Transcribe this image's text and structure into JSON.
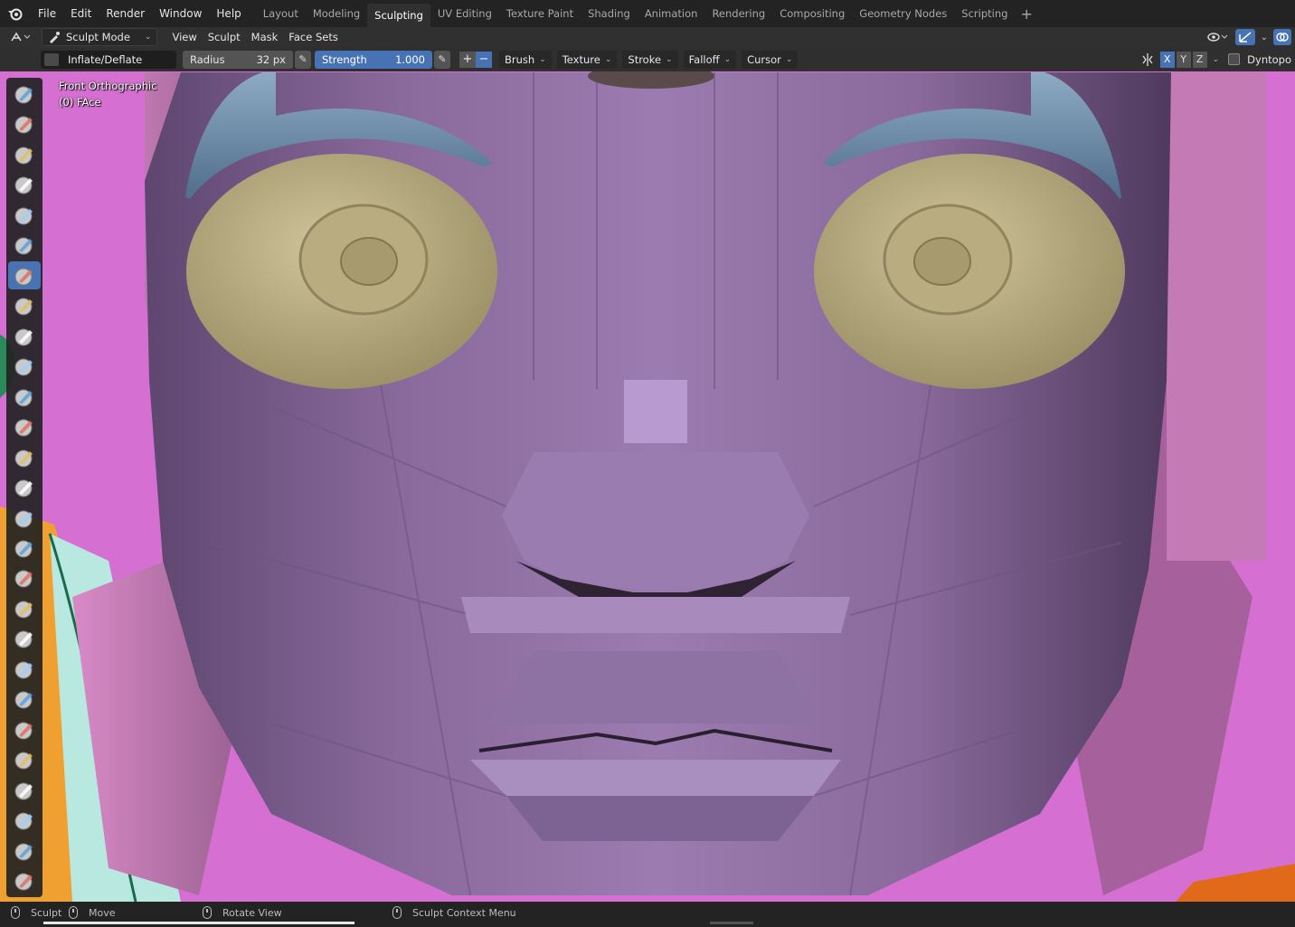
{
  "menu": {
    "items": [
      "File",
      "Edit",
      "Render",
      "Window",
      "Help"
    ]
  },
  "workspaces": {
    "tabs": [
      "Layout",
      "Modeling",
      "Sculpting",
      "UV Editing",
      "Texture Paint",
      "Shading",
      "Animation",
      "Rendering",
      "Compositing",
      "Geometry Nodes",
      "Scripting"
    ],
    "active": "Sculpting",
    "add_symbol": "+"
  },
  "header": {
    "mode": "Sculpt Mode",
    "menus": [
      "View",
      "Sculpt",
      "Mask",
      "Face Sets"
    ]
  },
  "tool_settings": {
    "brush_name": "Inflate/Deflate",
    "radius_label": "Radius",
    "radius_value": "32 px",
    "strength_label": "Strength",
    "strength_value": "1.000",
    "plus": "+",
    "minus": "−",
    "dropdowns": [
      "Brush",
      "Texture",
      "Stroke",
      "Falloff",
      "Cursor"
    ],
    "symmetry_axes": [
      "X",
      "Y",
      "Z"
    ],
    "dyntopo_label": "Dyntopo"
  },
  "viewport": {
    "view_name": "Front Orthographic",
    "object_name": "(0) FAce",
    "background_color": "#d56fd1",
    "skin_color": "#8a6a9a",
    "eye_color": "#bfb38a",
    "brow_color": "#6a8aa8",
    "ear_color": "#c47ab4"
  },
  "toolshelf": {
    "tools": [
      "draw-icon",
      "draw-sharp-icon",
      "clay-icon",
      "clay-strips-icon",
      "clay-thumb-icon",
      "layer-icon",
      "inflate-icon",
      "blob-icon",
      "crease-icon",
      "smooth-icon",
      "flatten-icon",
      "fill-icon",
      "scrape-icon",
      "multiplane-scrape-icon",
      "pinch-icon",
      "grab-icon",
      "elastic-deform-icon",
      "snake-hook-icon",
      "thumb-icon",
      "pose-icon",
      "nudge-icon",
      "rotate-icon",
      "slide-relax-icon",
      "boundary-icon",
      "cloth-icon",
      "simplify-icon",
      "mask-icon"
    ],
    "active_index": 6
  },
  "statusbar": {
    "items": [
      {
        "label": "Sculpt"
      },
      {
        "label": "Move"
      },
      {
        "label": "Rotate View"
      },
      {
        "label": "Sculpt Context Menu"
      }
    ]
  }
}
